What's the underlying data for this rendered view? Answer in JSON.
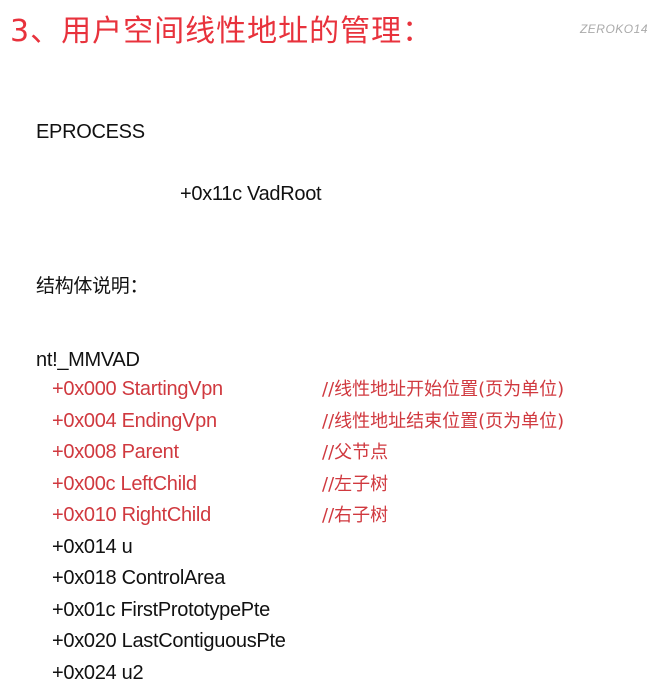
{
  "title": "3、用户空间线性地址的管理：",
  "watermark": "ZEROKO14",
  "eprocess": "EPROCESS",
  "vadroot": "+0x11c VadRoot",
  "description_label": "结构体说明：",
  "struct_name": "nt!_MMVAD",
  "fields": [
    {
      "name": "+0x000 StartingVpn",
      "comment": "//线性地址开始位置(页为单位)",
      "highlight": true
    },
    {
      "name": "+0x004 EndingVpn",
      "comment": "//线性地址结束位置(页为单位)",
      "highlight": true
    },
    {
      "name": "+0x008 Parent",
      "comment": "//父节点",
      "highlight": true
    },
    {
      "name": "+0x00c LeftChild",
      "comment": "//左子树",
      "highlight": true
    },
    {
      "name": "+0x010 RightChild",
      "comment": "//右子树",
      "highlight": true
    },
    {
      "name": "+0x014 u",
      "comment": "",
      "highlight": false
    },
    {
      "name": "+0x018 ControlArea",
      "comment": "",
      "highlight": false
    },
    {
      "name": "+0x01c FirstPrototypePte",
      "comment": "",
      "highlight": false
    },
    {
      "name": "+0x020 LastContiguousPte",
      "comment": "",
      "highlight": false
    },
    {
      "name": "+0x024 u2",
      "comment": "",
      "highlight": false
    }
  ],
  "colors": {
    "title": "#e8323c",
    "highlight": "#d0393f",
    "text": "#111111"
  }
}
